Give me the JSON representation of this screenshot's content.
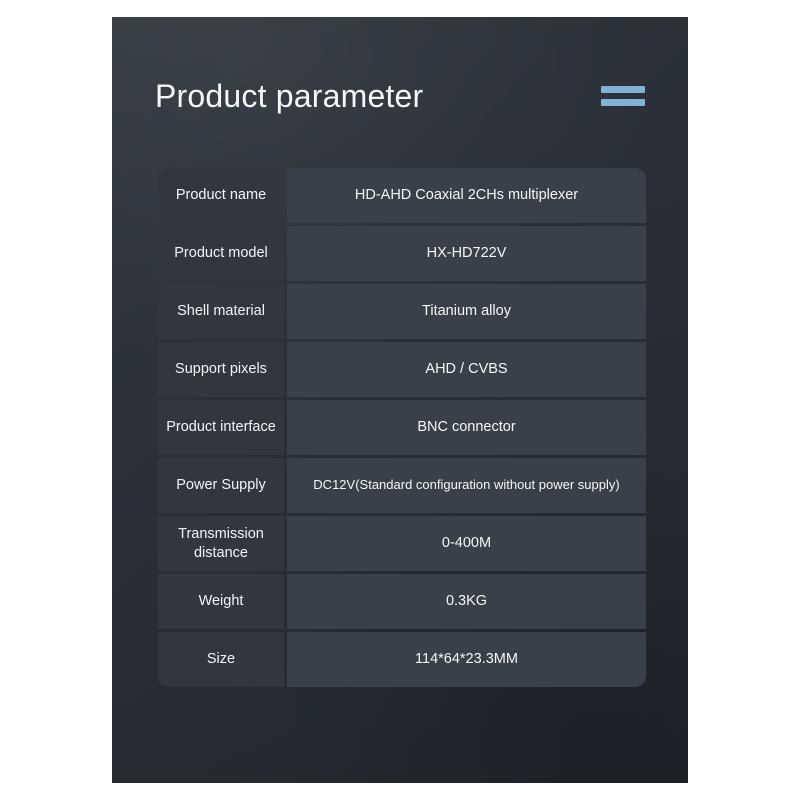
{
  "header": {
    "title": "Product parameter",
    "menu_icon": "equals-menu-icon"
  },
  "colors": {
    "panel_background": "#2a2f38",
    "label_cell": "#31363f",
    "value_cell": "#3a4049",
    "accent": "#81b2d6",
    "text": "#f4f6f8",
    "page_background": "#ffffff"
  },
  "spec_table": {
    "rows": [
      {
        "label": "Product name",
        "value": "HD-AHD Coaxial 2CHs multiplexer"
      },
      {
        "label": "Product model",
        "value": "HX-HD722V"
      },
      {
        "label": "Shell material",
        "value": "Titanium alloy"
      },
      {
        "label": "Support pixels",
        "value": "AHD / CVBS"
      },
      {
        "label": "Product interface",
        "value": "BNC connector"
      },
      {
        "label": "Power Supply",
        "value": "DC12V(Standard configuration without power supply)"
      },
      {
        "label": "Transmission distance",
        "value": "0-400M"
      },
      {
        "label": "Weight",
        "value": "0.3KG"
      },
      {
        "label": "Size",
        "value": "114*64*23.3MM"
      }
    ]
  }
}
